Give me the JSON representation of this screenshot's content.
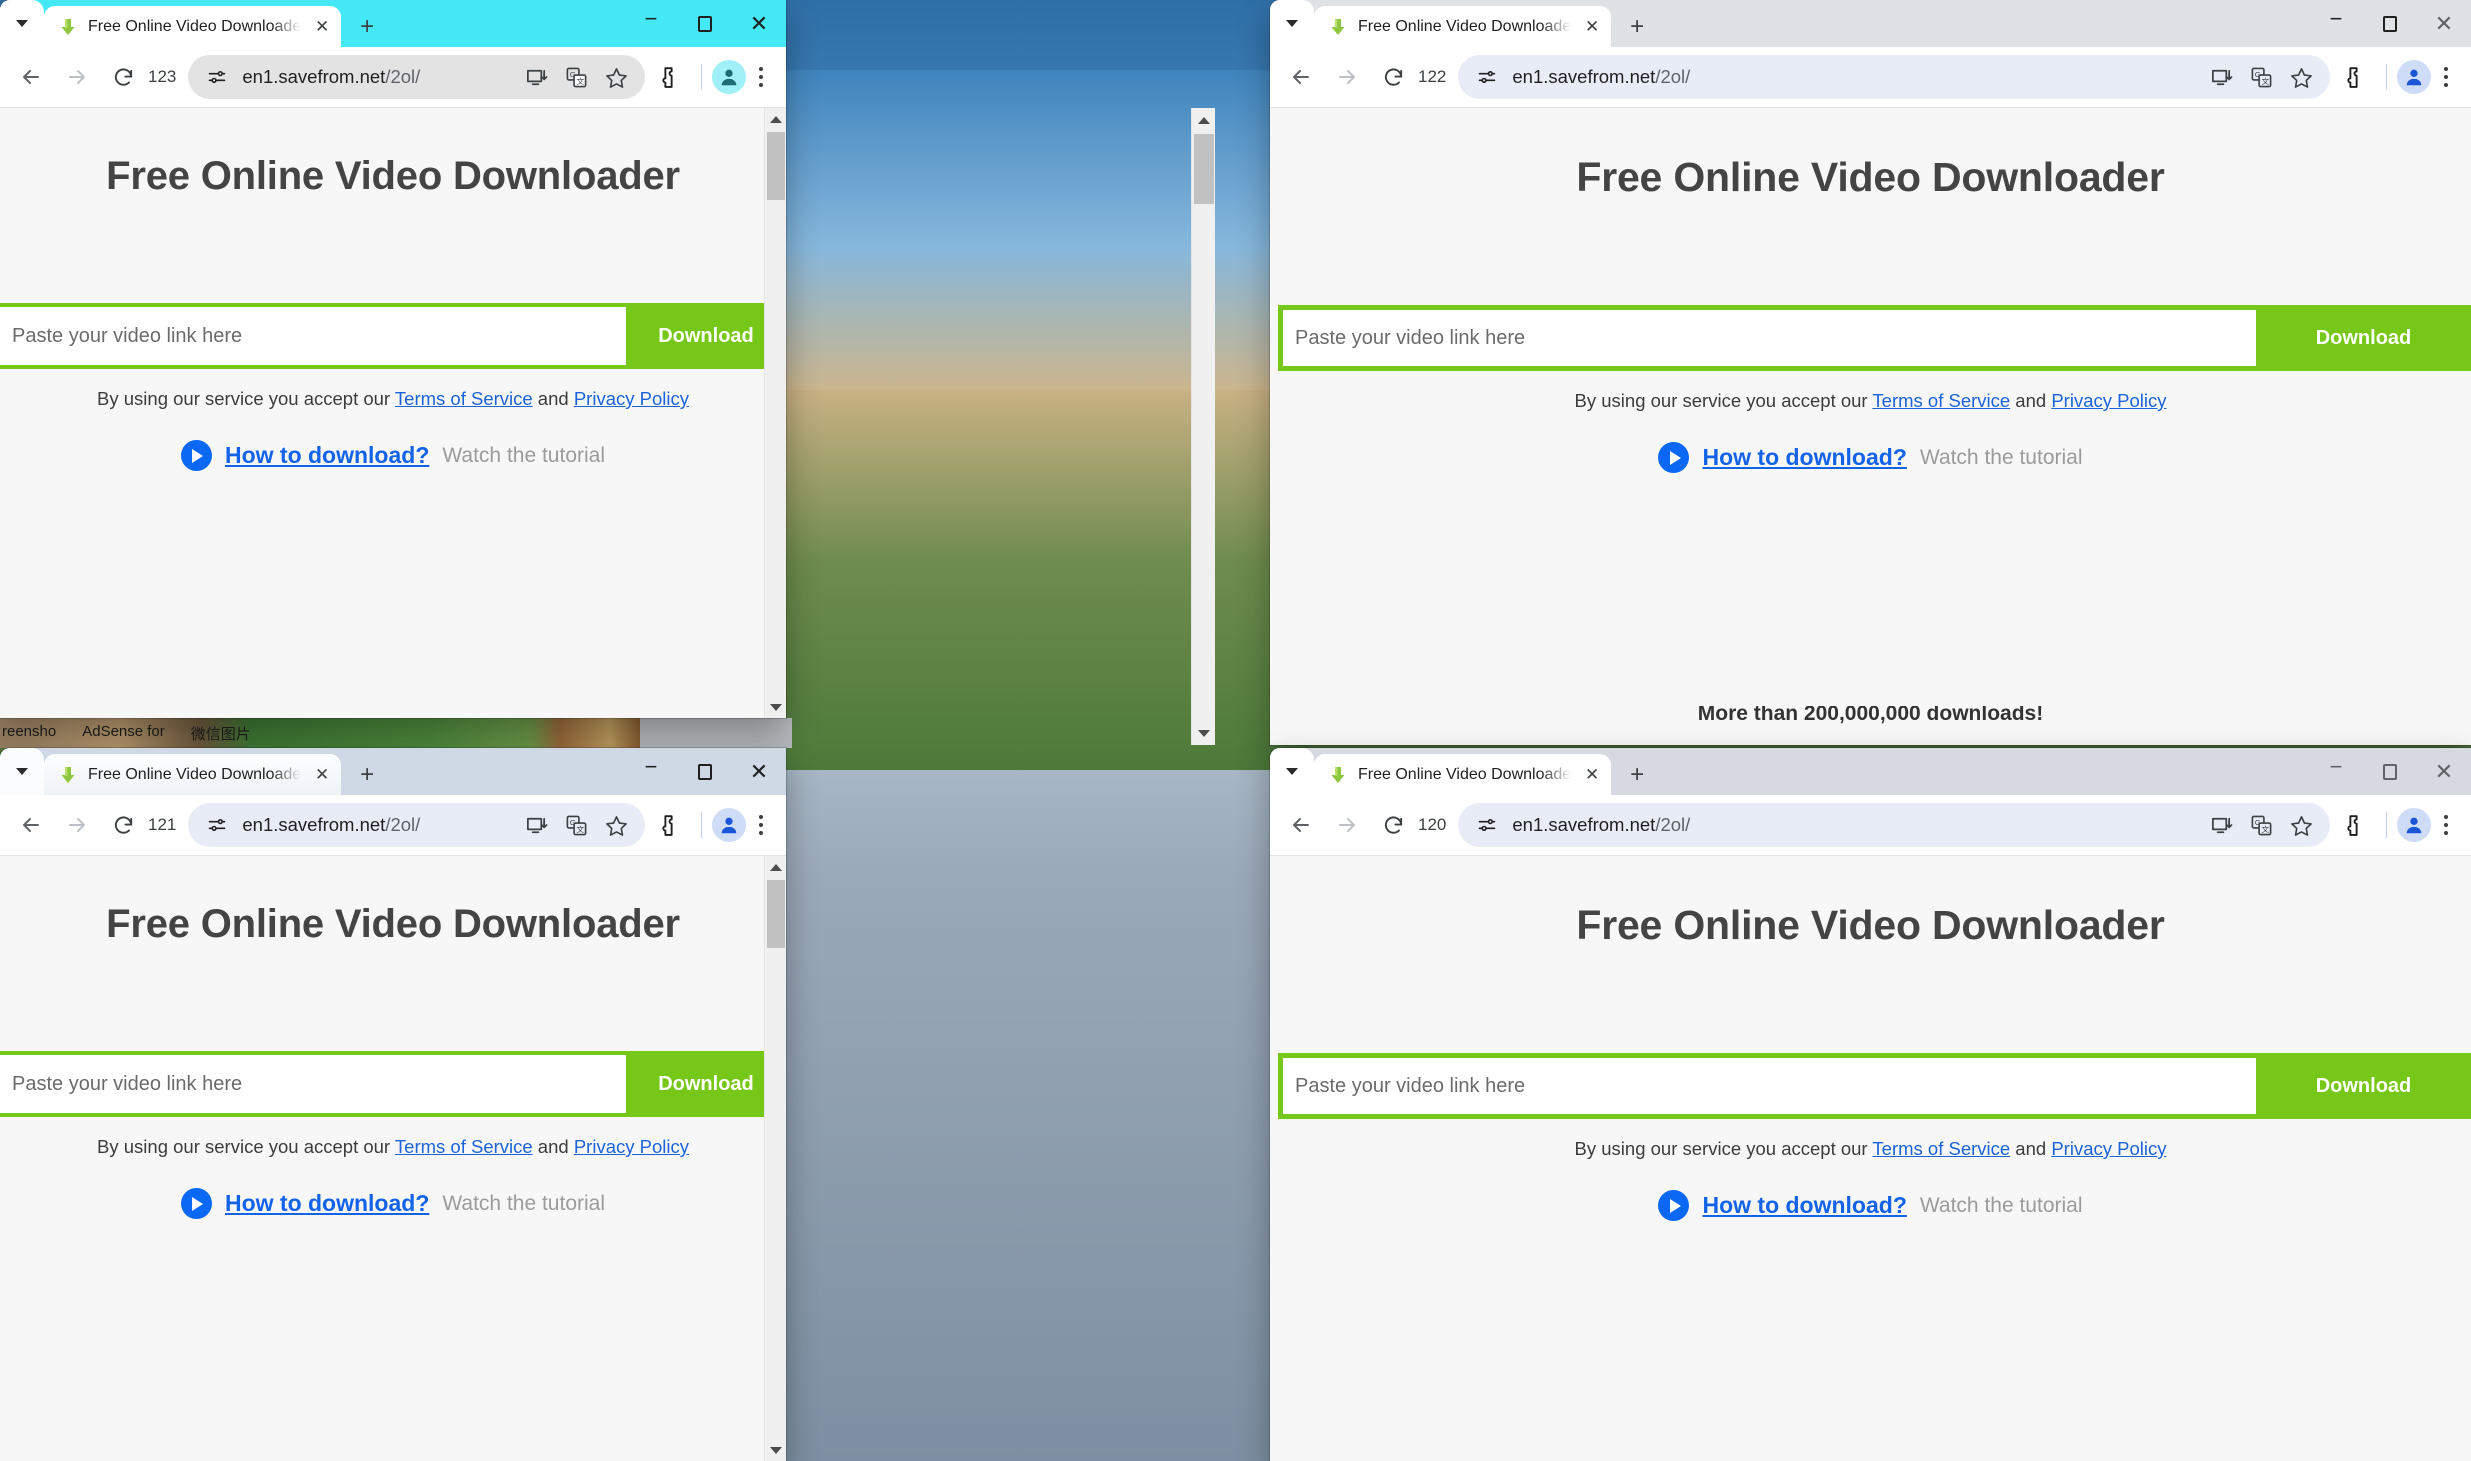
{
  "site": {
    "title": "Free Online Video Downloader",
    "input_placeholder": "Paste your video link here",
    "download_label": "Download",
    "terms_prefix": "By using our service you accept our ",
    "terms_link": "Terms of Service",
    "terms_and": " and ",
    "privacy_link": "Privacy Policy",
    "howto_link": "How to download?",
    "howto_sub": "Watch the tutorial",
    "more_downloads": "More than 200,000,000 downloads!"
  },
  "tab": {
    "title": "Free Online Video Downloade",
    "close_label": "✕",
    "newtab_label": "+",
    "favicon": "green-down-arrow-icon"
  },
  "windows": [
    {
      "id": "window-top-left",
      "reload_count": "123",
      "url_host": "en1.savefrom.net",
      "url_path": "/2ol/",
      "tabstrip_color": "#44e9f5",
      "omnibox_color": "#e3e3e3",
      "avatar_color": "#9ff0f7"
    },
    {
      "id": "window-top-right",
      "reload_count": "122",
      "url_host": "en1.savefrom.net",
      "url_path": "/2ol/",
      "tabstrip_color": "#dee1e6",
      "omnibox_color": "#e8ecf7",
      "avatar_color": "#cfdcf8"
    },
    {
      "id": "window-bottom-left",
      "reload_count": "121",
      "url_host": "en1.savefrom.net",
      "url_path": "/2ol/",
      "tabstrip_color": "#cfd9e6",
      "omnibox_color": "#e8ecf7",
      "avatar_color": "#cfdcf8"
    },
    {
      "id": "window-bottom-right",
      "reload_count": "120",
      "url_host": "en1.savefrom.net",
      "url_path": "/2ol/",
      "tabstrip_color": "#d6dae0",
      "omnibox_color": "#e8ecf7",
      "avatar_color": "#cfdcf8"
    }
  ],
  "window_controls": {
    "minimize": "−",
    "maximize": "□",
    "close": "✕"
  },
  "toolbar_icons": {
    "back": "back-arrow-icon",
    "forward": "forward-arrow-icon",
    "reload": "reload-icon",
    "site_info": "site-settings-icon",
    "install": "install-app-icon",
    "translate": "translate-icon",
    "bookmark": "star-icon",
    "extensions": "extensions-puzzle-icon",
    "profile": "profile-avatar-icon",
    "menu": "kebab-menu-icon"
  },
  "background_app": {
    "tab1": "reensho",
    "tab2": "AdSense for",
    "tab3": "微信图片"
  }
}
